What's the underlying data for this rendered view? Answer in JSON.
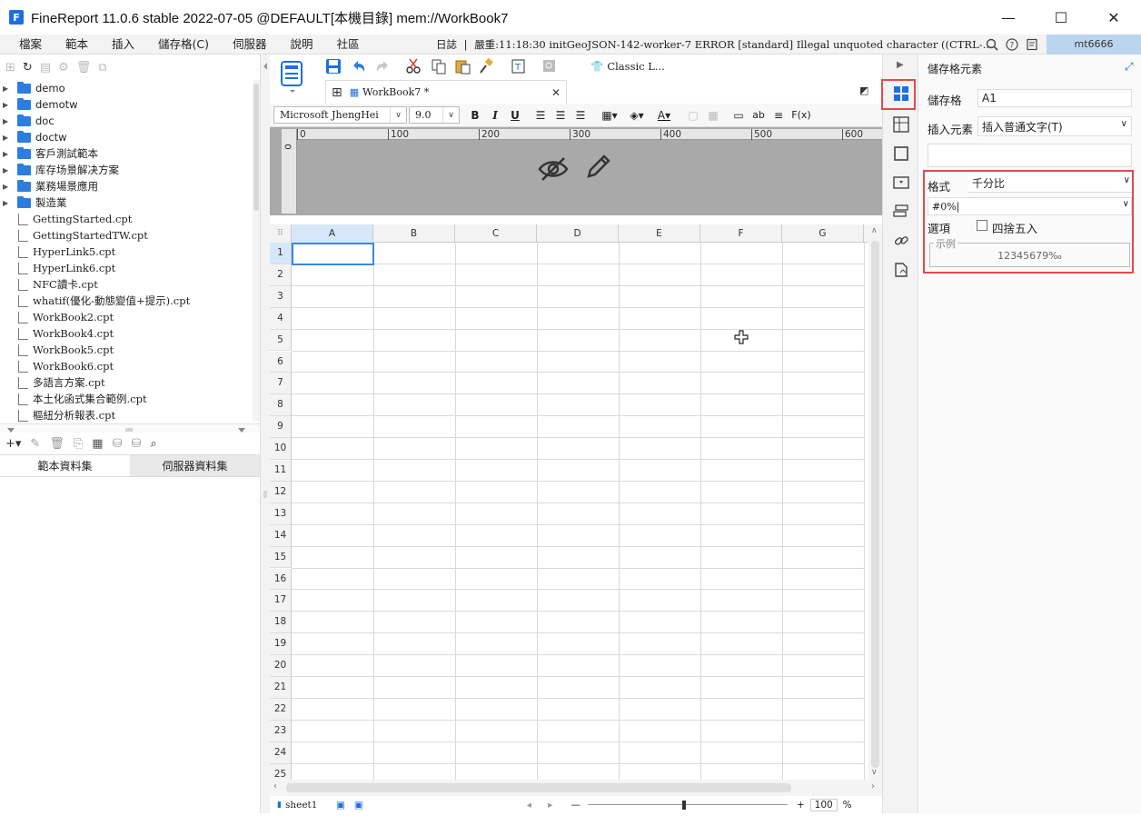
{
  "app": {
    "title": "FineReport 11.0.6 stable 2022-07-05 @DEFAULT[本機目錄]     mem://WorkBook7",
    "logo_letter": "F"
  },
  "menu": [
    "檔案",
    "範本",
    "插入",
    "儲存格(C)",
    "伺服器",
    "說明",
    "社區"
  ],
  "log": {
    "label": "日誌",
    "text": "嚴重:11:18:30 initGeoJSON-142-worker-7 ERROR [standard] Illegal unquoted character ((CTRL-..."
  },
  "user": "mt6666",
  "tree": [
    {
      "type": "folder",
      "name": "demo"
    },
    {
      "type": "folder",
      "name": "demotw"
    },
    {
      "type": "folder",
      "name": "doc"
    },
    {
      "type": "folder",
      "name": "doctw"
    },
    {
      "type": "folder",
      "name": "客戶測試範本"
    },
    {
      "type": "folder",
      "name": "库存场景解决方案"
    },
    {
      "type": "folder",
      "name": "業務場景應用"
    },
    {
      "type": "folder",
      "name": "製造業"
    },
    {
      "type": "file",
      "name": "GettingStarted.cpt"
    },
    {
      "type": "file",
      "name": "GettingStartedTW.cpt"
    },
    {
      "type": "file",
      "name": "HyperLink5.cpt"
    },
    {
      "type": "file",
      "name": "HyperLink6.cpt"
    },
    {
      "type": "file",
      "name": "NFC讀卡.cpt"
    },
    {
      "type": "file",
      "name": "whatif(優化-動態變值+提示).cpt"
    },
    {
      "type": "file",
      "name": "WorkBook2.cpt"
    },
    {
      "type": "file",
      "name": "WorkBook4.cpt"
    },
    {
      "type": "file",
      "name": "WorkBook5.cpt"
    },
    {
      "type": "file",
      "name": "WorkBook6.cpt"
    },
    {
      "type": "file",
      "name": "多語言方案.cpt"
    },
    {
      "type": "file",
      "name": "本土化函式集合範例.cpt"
    },
    {
      "type": "file",
      "name": "樞紐分析報表.cpt"
    }
  ],
  "ds_tabs": [
    "範本資料集",
    "伺服器資料集"
  ],
  "toolbar": {
    "theme": "Classic L..."
  },
  "doc_tab": {
    "label": "WorkBook7 *"
  },
  "format_bar": {
    "font": "Microsoft JhengHei",
    "size": "9.0",
    "bold": "B",
    "italic": "I",
    "underline": "U",
    "text_btn": "ab",
    "fx": "F(x)"
  },
  "ruler": {
    "ticks": [
      "0",
      "100",
      "200",
      "300",
      "400",
      "500",
      "600"
    ],
    "vtick": "0"
  },
  "grid": {
    "columns": [
      "A",
      "B",
      "C",
      "D",
      "E",
      "F",
      "G"
    ],
    "rows": [
      "1",
      "2",
      "3",
      "4",
      "5",
      "6",
      "7",
      "8",
      "9",
      "10",
      "11",
      "12",
      "13",
      "14",
      "15",
      "16",
      "17",
      "18",
      "19",
      "20",
      "21",
      "22",
      "23",
      "24",
      "25"
    ]
  },
  "sheet": {
    "name": "sheet1",
    "zoom": "100",
    "zoom_unit": "%"
  },
  "panel": {
    "title": "儲存格元素",
    "cell_label": "儲存格",
    "cell_value": "A1",
    "insert_label": "插入元素",
    "insert_value": "插入普通文字(T)",
    "format_label": "格式",
    "format_value": "千分比",
    "pattern_value": "#0%|",
    "option_label": "選項",
    "round_label": "四捨五入",
    "example_label": "示例",
    "example_value": "12345679‰"
  },
  "colors": {
    "accent": "#1d6fe0",
    "highlight": "#e24b4b",
    "selection": "#3a87e0"
  }
}
